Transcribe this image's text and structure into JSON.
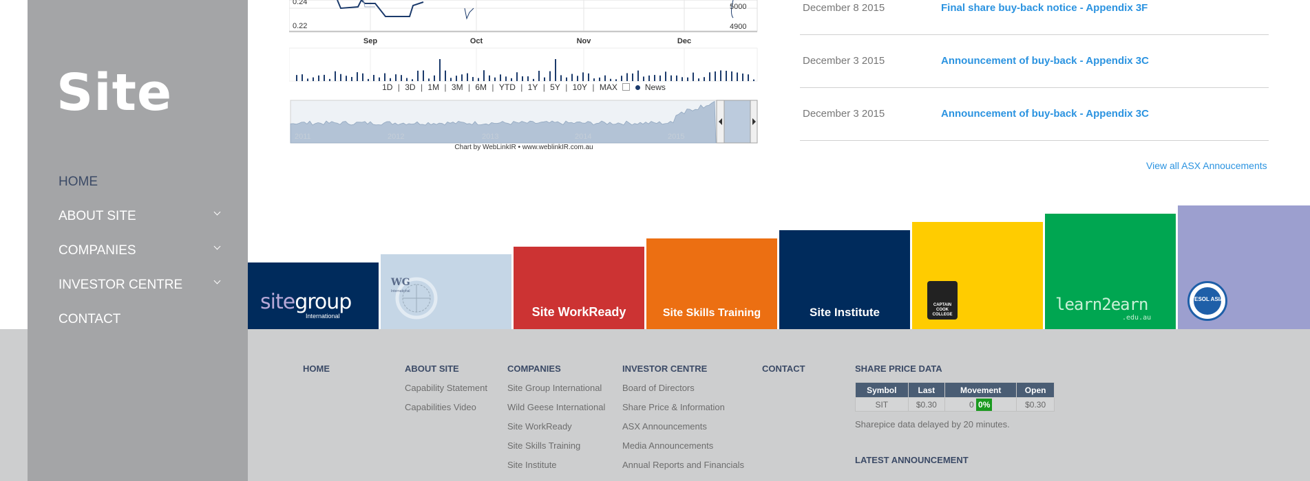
{
  "sidebar": {
    "logo": "Site",
    "nav": [
      {
        "label": "HOME",
        "active": true,
        "has_submenu": false
      },
      {
        "label": "ABOUT SITE",
        "active": false,
        "has_submenu": true
      },
      {
        "label": "COMPANIES",
        "active": false,
        "has_submenu": true
      },
      {
        "label": "INVESTOR CENTRE",
        "active": false,
        "has_submenu": true
      },
      {
        "label": "CONTACT",
        "active": false,
        "has_submenu": false
      }
    ]
  },
  "chart_data": {
    "type": "line",
    "y_tick_labels": [
      "0.24",
      "0.22"
    ],
    "volume_tick_labels": [
      "5000",
      "4900"
    ],
    "x_tick_labels": [
      "Sep",
      "Oct",
      "Nov",
      "Dec"
    ],
    "navigator_years": [
      "2011",
      "2012",
      "2013",
      "2014",
      "2015"
    ],
    "range_buttons": [
      "1D",
      "3D",
      "1M",
      "3M",
      "6M",
      "YTD",
      "1Y",
      "5Y",
      "10Y",
      "MAX"
    ],
    "news_label": "News",
    "credit": "Chart by WebLinkIR • www.weblinkIR.com.au",
    "colors": {
      "line": "#1b3a6b",
      "volume": "#1b3a6b",
      "navigator": "#b3c3d6"
    }
  },
  "announcements": [
    {
      "date": "December 8 2015",
      "title": "Final share buy-back notice - Appendix 3F"
    },
    {
      "date": "December 3 2015",
      "title": "Announcement of buy-back - Appendix 3C"
    },
    {
      "date": "December 3 2015",
      "title": "Announcement of buy-back - Appendix 3C"
    }
  ],
  "view_all_label": "View all ASX Annoucements",
  "companies": [
    {
      "name": "sitegroup",
      "sub": "International",
      "color": "#002b5c"
    },
    {
      "name": "WG",
      "sub": "International",
      "color": "#c5d6e6"
    },
    {
      "name": "Site WorkReady",
      "color": "#cc3333"
    },
    {
      "name": "Site Skills Training",
      "color": "#ec6f12"
    },
    {
      "name": "Site Institute",
      "color": "#002b5c"
    },
    {
      "name": "CAPTAIN COOK COLLEGE",
      "color": "#ffcc00"
    },
    {
      "name": "learn2earn",
      "sub": ".edu.au",
      "color": "#00a651"
    },
    {
      "name": "TESOL ASIA",
      "color": "#9c9fcf"
    }
  ],
  "footer": {
    "home": "HOME",
    "about": {
      "title": "ABOUT SITE",
      "links": [
        "Capability Statement",
        "Capabilities Video"
      ]
    },
    "companies": {
      "title": "COMPANIES",
      "links": [
        "Site Group International",
        "Wild Geese International",
        "Site WorkReady",
        "Site Skills Training",
        "Site Institute"
      ]
    },
    "investor": {
      "title": "INVESTOR CENTRE",
      "links": [
        "Board of Directors",
        "Share Price & Information",
        "ASX Announcements",
        "Media Announcements",
        "Annual Reports and Financials"
      ]
    },
    "contact": "CONTACT",
    "share": {
      "title": "SHARE PRICE DATA",
      "headers": [
        "Symbol",
        "Last",
        "Movement",
        "Open"
      ],
      "row": {
        "symbol": "SIT",
        "last": "$0.30",
        "movement": "0",
        "movement_pct": "0%",
        "open": "$0.30"
      },
      "delay_note": "Sharepice data delayed by 20 minutes.",
      "latest_title": "LATEST ANNOUNCEMENT"
    }
  }
}
